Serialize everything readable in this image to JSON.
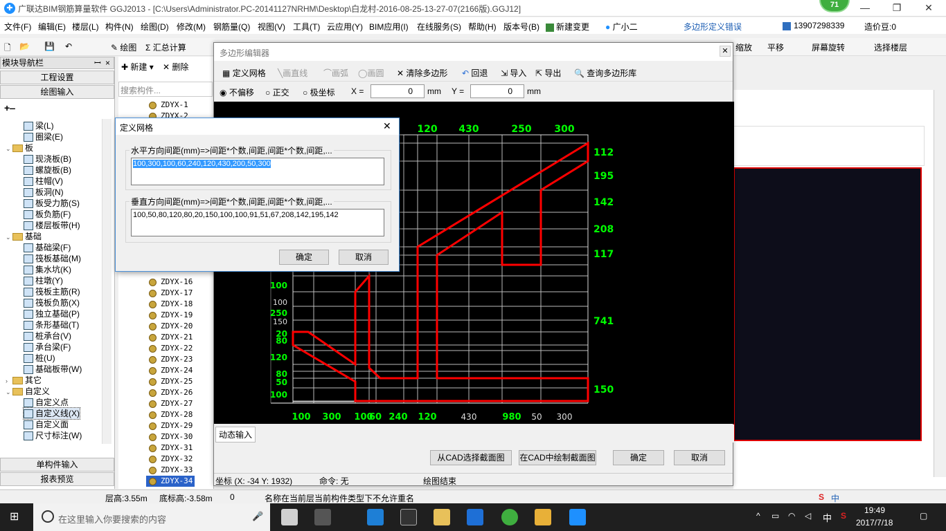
{
  "window": {
    "title": "广联达BIM钢筋算量软件 GGJ2013 - [C:\\Users\\Administrator.PC-20141127NRHM\\Desktop\\白龙村-2016-08-25-13-27-07(2166版).GGJ12]",
    "badge": "71",
    "minimize": "—",
    "restore": "❐",
    "close": "✕"
  },
  "menu": {
    "items": [
      "文件(F)",
      "编辑(E)",
      "楼层(L)",
      "构件(N)",
      "绘图(D)",
      "修改(M)",
      "钢筋量(Q)",
      "视图(V)",
      "工具(T)",
      "云应用(Y)",
      "BIM应用(I)",
      "在线服务(S)",
      "帮助(H)",
      "版本号(B)",
      "新建变更",
      "广小二"
    ],
    "notice": "多边形定义错误",
    "phone": "13907298339",
    "coin": "造价豆:0"
  },
  "toolbar": {
    "draw": "绘图",
    "sum": "汇总计算",
    "zoom": "缩放",
    "pan": "平移",
    "rotate": "屏幕旋转",
    "select_floor": "选择楼层"
  },
  "nav": {
    "header": "模块导航栏",
    "pin": "ꟷ",
    "close": "×",
    "project_settings": "工程设置",
    "draw_input": "绘图输入",
    "single_input": "单构件输入",
    "report": "报表预览",
    "tree": [
      {
        "label": "梁(L)",
        "level": 2
      },
      {
        "label": "圈梁(E)",
        "level": 2
      },
      {
        "label": "板",
        "level": 1,
        "folder": true
      },
      {
        "label": "现浇板(B)",
        "level": 2
      },
      {
        "label": "螺旋板(B)",
        "level": 2
      },
      {
        "label": "柱帽(V)",
        "level": 2
      },
      {
        "label": "板洞(N)",
        "level": 2
      },
      {
        "label": "板受力筋(S)",
        "level": 2
      },
      {
        "label": "板负筋(F)",
        "level": 2
      },
      {
        "label": "楼层板带(H)",
        "level": 2
      },
      {
        "label": "基础",
        "level": 1,
        "folder": true
      },
      {
        "label": "基础梁(F)",
        "level": 2
      },
      {
        "label": "筏板基础(M)",
        "level": 2
      },
      {
        "label": "集水坑(K)",
        "level": 2
      },
      {
        "label": "柱墩(Y)",
        "level": 2
      },
      {
        "label": "筏板主筋(R)",
        "level": 2
      },
      {
        "label": "筏板负筋(X)",
        "level": 2
      },
      {
        "label": "独立基础(P)",
        "level": 2
      },
      {
        "label": "条形基础(T)",
        "level": 2
      },
      {
        "label": "桩承台(V)",
        "level": 2
      },
      {
        "label": "承台梁(F)",
        "level": 2
      },
      {
        "label": "桩(U)",
        "level": 2
      },
      {
        "label": "基础板带(W)",
        "level": 2
      },
      {
        "label": "其它",
        "level": 1,
        "folder": true,
        "collapsed": true
      },
      {
        "label": "自定义",
        "level": 1,
        "folder": true
      },
      {
        "label": "自定义点",
        "level": 2
      },
      {
        "label": "自定义线(X)",
        "level": 2,
        "selected": true
      },
      {
        "label": "自定义面",
        "level": 2
      },
      {
        "label": "尺寸标注(W)",
        "level": 2
      }
    ]
  },
  "components": {
    "new": "新建",
    "delete": "删除",
    "search_placeholder": "搜索构件...",
    "items": [
      "ZDYX-1",
      "ZDYX-2",
      "ZDYX-16",
      "ZDYX-17",
      "ZDYX-18",
      "ZDYX-19",
      "ZDYX-20",
      "ZDYX-21",
      "ZDYX-22",
      "ZDYX-23",
      "ZDYX-24",
      "ZDYX-25",
      "ZDYX-26",
      "ZDYX-27",
      "ZDYX-28",
      "ZDYX-29",
      "ZDYX-30",
      "ZDYX-31",
      "ZDYX-32",
      "ZDYX-33",
      "ZDYX-34"
    ]
  },
  "poly_editor": {
    "title": "多边形编辑器",
    "tools": {
      "define_grid": "定义网格",
      "line": "画直线",
      "arc": "画弧",
      "circle": "画圆",
      "clear": "清除多边形",
      "undo": "回退",
      "import": "导入",
      "export": "导出",
      "query": "查询多边形库"
    },
    "offset": {
      "none": "不偏移",
      "ortho": "正交",
      "polar": "极坐标",
      "x_label": "X =",
      "x_value": "0",
      "y_label": "Y =",
      "y_value": "0",
      "unit": "mm"
    },
    "dynamic_input": "动态输入",
    "buttons": {
      "cad_select": "从CAD选择截面图",
      "cad_draw": "在CAD中绘制截面图",
      "ok": "确定",
      "cancel": "取消"
    },
    "status": {
      "coord": "坐标 (X: -34 Y: 1932)",
      "command": "命令: 无",
      "state": "绘图结束"
    }
  },
  "grid_dialog": {
    "title": "定义网格",
    "close": "✕",
    "h_label": "水平方向间距(mm)=>间距*个数,间距,间距*个数,间距,...",
    "h_value": "100,300,100,60,240,120,430,200,50,300",
    "v_label": "垂直方向间距(mm)=>间距*个数,间距,间距*个数,间距,...",
    "v_value": "100,50,80,120,80,20,150,100,100,91,51,67,208,142,195,142",
    "ok": "确定",
    "cancel": "取消"
  },
  "chart_data": {
    "type": "diagram",
    "top_labels": [
      "120",
      "430",
      "250",
      "300"
    ],
    "right_labels": [
      "112",
      "195",
      "142",
      "208",
      "117",
      "741",
      "150"
    ],
    "bottom_labels": [
      "100",
      "300",
      "100",
      "60",
      "240",
      "120",
      "430",
      "980",
      "50",
      "300"
    ],
    "left_labels": [
      "100",
      "100",
      "250",
      "150",
      "20",
      "80",
      "120",
      "80",
      "50",
      "100"
    ]
  },
  "statusbar": {
    "floor_height": "层高:3.55m",
    "base_height": "底标高:-3.58m",
    "zero": "0",
    "message": "名称在当前层当前构件类型下不允许重名"
  },
  "taskbar": {
    "search": "在这里输入你要搜索的内容",
    "time": "19:49",
    "date": "2017/7/18",
    "ime": "中",
    "tray_ime": "中"
  }
}
